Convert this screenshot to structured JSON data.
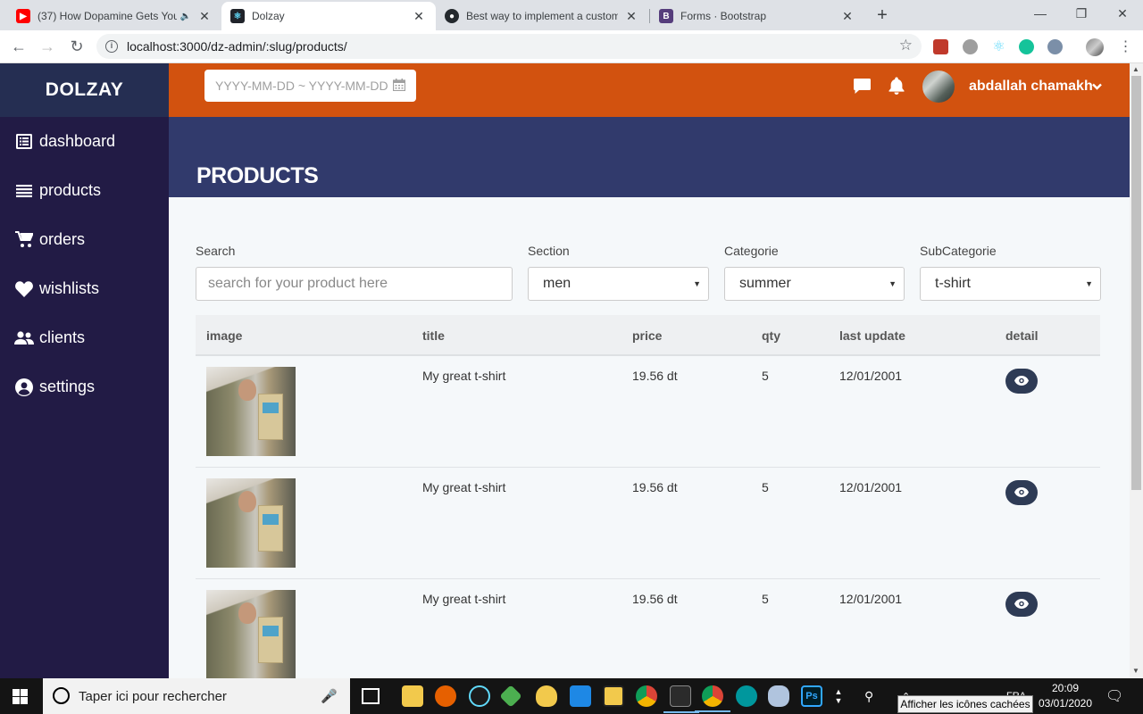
{
  "browser": {
    "tabs": [
      {
        "title": "(37) How Dopamine Gets You",
        "favicon": "youtube-icon",
        "audio": true
      },
      {
        "title": "Dolzay",
        "favicon": "react-icon",
        "active": true
      },
      {
        "title": "Best way to implement a custom",
        "favicon": "github-icon"
      },
      {
        "title": "Forms · Bootstrap",
        "favicon": "bootstrap-icon"
      }
    ],
    "url": "localhost:3000/dz-admin/:slug/products/",
    "colors": {
      "tabstrip": "#dee1e6",
      "active_tab": "#ffffff"
    }
  },
  "sidebar": {
    "brand": "DOLZAY",
    "items": [
      {
        "label": "dashboard",
        "icon": "list-alt-icon"
      },
      {
        "label": "products",
        "icon": "bars-icon"
      },
      {
        "label": "orders",
        "icon": "cart-icon"
      },
      {
        "label": "wishlists",
        "icon": "heart-icon"
      },
      {
        "label": "clients",
        "icon": "users-icon"
      },
      {
        "label": "settings",
        "icon": "user-circle-icon"
      }
    ]
  },
  "topbar": {
    "date_placeholder": "YYYY-MM-DD ~ YYYY-MM-DD",
    "user_name": "abdallah chamakh",
    "colors": {
      "topbar": "#d2520f",
      "sidebar": "#221b45",
      "header": "#313a6c"
    }
  },
  "page": {
    "title": "PRODUCTS"
  },
  "filters": {
    "search": {
      "label": "Search",
      "placeholder": "search for your product here"
    },
    "section": {
      "label": "Section",
      "value": "men"
    },
    "categorie": {
      "label": "Categorie",
      "value": "summer"
    },
    "subcategorie": {
      "label": "SubCategorie",
      "value": "t-shirt"
    }
  },
  "table": {
    "headers": [
      "image",
      "title",
      "price",
      "qty",
      "last update",
      "detail"
    ],
    "rows": [
      {
        "title": "My great t-shirt",
        "price": "19.56 dt",
        "qty": "5",
        "last_update": "12/01/2001"
      },
      {
        "title": "My great t-shirt",
        "price": "19.56 dt",
        "qty": "5",
        "last_update": "12/01/2001"
      },
      {
        "title": "My great t-shirt",
        "price": "19.56 dt",
        "qty": "5",
        "last_update": "12/01/2001"
      }
    ]
  },
  "taskbar": {
    "search_placeholder": "Taper ici pour rechercher",
    "lang": "FRA",
    "time": "20:09",
    "date": "03/01/2020",
    "tooltip": "Afficher les icônes cachées"
  }
}
